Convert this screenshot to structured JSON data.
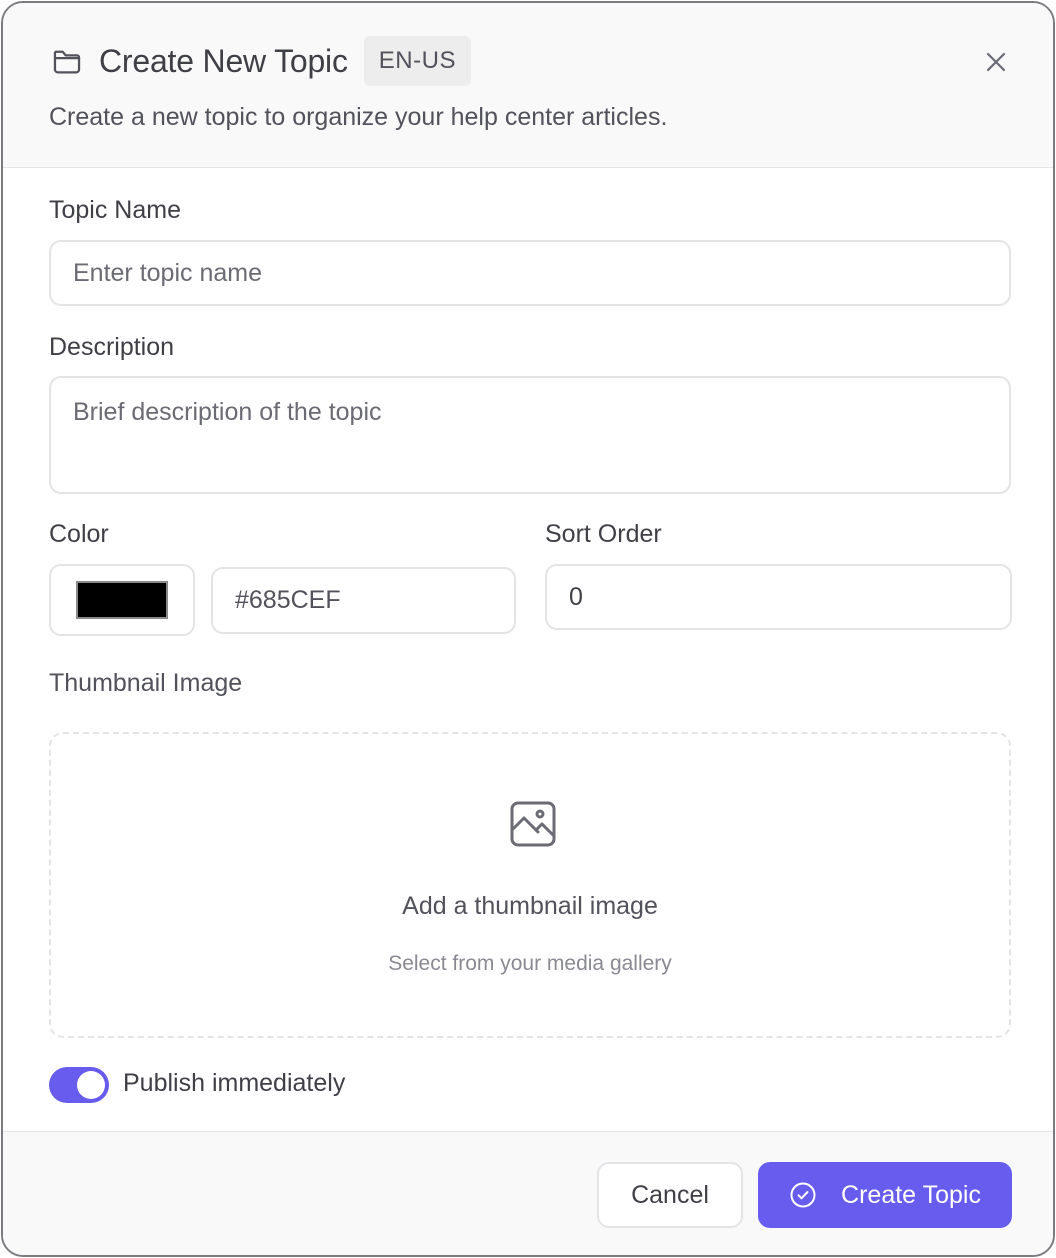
{
  "dialog": {
    "title": "Create New Topic",
    "language_badge": "EN-US",
    "subtitle": "Create a new topic to organize your help center articles.",
    "title_icon": "folder-icon",
    "close_icon": "close-icon"
  },
  "form": {
    "topic_name": {
      "label": "Topic Name",
      "placeholder": "Enter topic name",
      "value": ""
    },
    "description": {
      "label": "Description",
      "placeholder": "Brief description of the topic",
      "value": ""
    },
    "color": {
      "label": "Color",
      "swatch_color": "#000000",
      "hex_value": "#685CEF"
    },
    "sort_order": {
      "label": "Sort Order",
      "value": "0"
    },
    "thumbnail": {
      "label": "Thumbnail Image",
      "icon": "image-icon",
      "title": "Add a thumbnail image",
      "hint": "Select from your media gallery"
    },
    "publish": {
      "label": "Publish immediately",
      "enabled": true
    }
  },
  "footer": {
    "cancel_label": "Cancel",
    "create_label": "Create Topic",
    "create_icon": "check-circle-icon"
  },
  "colors": {
    "accent": "#685CEF",
    "border": "#E4E4E7",
    "header_bg": "#F9F9FA"
  }
}
